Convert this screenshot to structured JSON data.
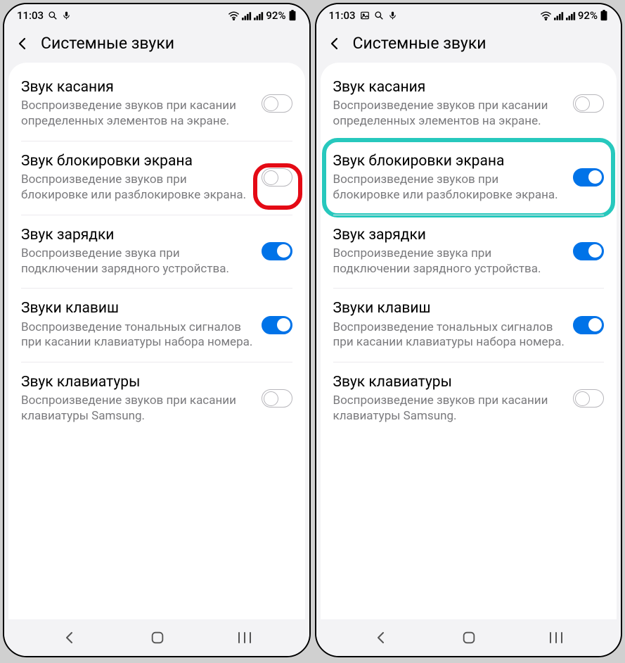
{
  "status": {
    "time": "11:03",
    "battery": "92%"
  },
  "header": {
    "title": "Системные звуки"
  },
  "items": [
    {
      "title": "Звук касания",
      "desc": "Воспроизведение звуков при касании определенных элементов на экране.",
      "name": "touch-sound"
    },
    {
      "title": "Звук блокировки экрана",
      "desc": "Воспроизведение звуков при блокировке или разблокировке экрана.",
      "name": "screen-lock-sound"
    },
    {
      "title": "Звук зарядки",
      "desc": "Воспроизведение звука при подключении зарядного устройства.",
      "name": "charging-sound"
    },
    {
      "title": "Звуки клавиш",
      "desc": "Воспроизведение тональных сигналов при касании клавиатуры набора номера.",
      "name": "dialpad-sound"
    },
    {
      "title": "Звук клавиатуры",
      "desc": "Воспроизведение звуков при касании клавиатуры Samsung.",
      "name": "keyboard-sound"
    }
  ],
  "screens": [
    {
      "id": "left",
      "status_icons": [
        "search-icon",
        "mic-icon"
      ],
      "toggles": [
        false,
        false,
        true,
        true,
        false
      ],
      "highlight": {
        "kind": "red",
        "target_index": 1,
        "box": "toggle"
      }
    },
    {
      "id": "right",
      "status_icons": [
        "image-icon",
        "search-icon",
        "mic-icon"
      ],
      "toggles": [
        false,
        true,
        true,
        true,
        false
      ],
      "highlight": {
        "kind": "teal",
        "target_index": 1,
        "box": "row"
      }
    }
  ]
}
